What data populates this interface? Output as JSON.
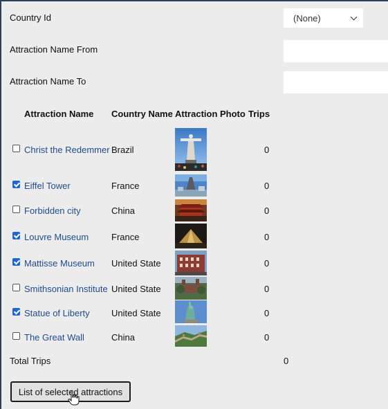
{
  "filters": {
    "country_id_label": "Country Id",
    "country_id_value": "(None)",
    "name_from_label": "Attraction Name From",
    "name_from_value": "",
    "name_to_label": "Attraction Name To",
    "name_to_value": ""
  },
  "table": {
    "headers": [
      "Attraction Name",
      "Country Name",
      "Attraction Photo",
      "Trips"
    ],
    "rows": [
      {
        "name": "Christ the Redemmer",
        "country": "Brazil",
        "trips": "0",
        "checked": false,
        "photo": "christ-the-redeemer-photo"
      },
      {
        "name": "Eiffel Tower",
        "country": "France",
        "trips": "0",
        "checked": true,
        "photo": "eiffel-tower-photo"
      },
      {
        "name": "Forbidden city",
        "country": "China",
        "trips": "0",
        "checked": false,
        "photo": "forbidden-city-photo"
      },
      {
        "name": "Louvre Museum",
        "country": "France",
        "trips": "0",
        "checked": true,
        "photo": "louvre-museum-photo"
      },
      {
        "name": "Mattisse Museum",
        "country": "United State",
        "trips": "0",
        "checked": true,
        "photo": "mattisse-museum-photo"
      },
      {
        "name": "Smithsonian Institute",
        "country": "United State",
        "trips": "0",
        "checked": false,
        "photo": "smithsonian-photo"
      },
      {
        "name": "Statue of Liberty",
        "country": "United State",
        "trips": "0",
        "checked": true,
        "photo": "statue-of-liberty-photo"
      },
      {
        "name": "The Great Wall",
        "country": "China",
        "trips": "0",
        "checked": false,
        "photo": "great-wall-photo"
      }
    ]
  },
  "totals": {
    "label": "Total Trips",
    "value": "0"
  },
  "actions": {
    "list_button": "List of selected attractions"
  },
  "colors": {
    "link": "#1f4b8e",
    "checkbox": "#1e66d0",
    "background": "#ececec"
  }
}
